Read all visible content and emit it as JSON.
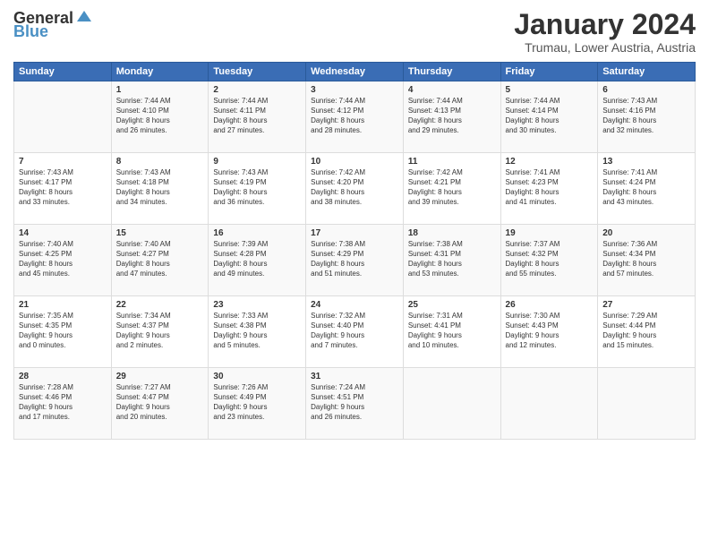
{
  "logo": {
    "general": "General",
    "blue": "Blue"
  },
  "title": "January 2024",
  "subtitle": "Trumau, Lower Austria, Austria",
  "header_days": [
    "Sunday",
    "Monday",
    "Tuesday",
    "Wednesday",
    "Thursday",
    "Friday",
    "Saturday"
  ],
  "weeks": [
    [
      {
        "day": "",
        "info": ""
      },
      {
        "day": "1",
        "info": "Sunrise: 7:44 AM\nSunset: 4:10 PM\nDaylight: 8 hours\nand 26 minutes."
      },
      {
        "day": "2",
        "info": "Sunrise: 7:44 AM\nSunset: 4:11 PM\nDaylight: 8 hours\nand 27 minutes."
      },
      {
        "day": "3",
        "info": "Sunrise: 7:44 AM\nSunset: 4:12 PM\nDaylight: 8 hours\nand 28 minutes."
      },
      {
        "day": "4",
        "info": "Sunrise: 7:44 AM\nSunset: 4:13 PM\nDaylight: 8 hours\nand 29 minutes."
      },
      {
        "day": "5",
        "info": "Sunrise: 7:44 AM\nSunset: 4:14 PM\nDaylight: 8 hours\nand 30 minutes."
      },
      {
        "day": "6",
        "info": "Sunrise: 7:43 AM\nSunset: 4:16 PM\nDaylight: 8 hours\nand 32 minutes."
      }
    ],
    [
      {
        "day": "7",
        "info": "Sunrise: 7:43 AM\nSunset: 4:17 PM\nDaylight: 8 hours\nand 33 minutes."
      },
      {
        "day": "8",
        "info": "Sunrise: 7:43 AM\nSunset: 4:18 PM\nDaylight: 8 hours\nand 34 minutes."
      },
      {
        "day": "9",
        "info": "Sunrise: 7:43 AM\nSunset: 4:19 PM\nDaylight: 8 hours\nand 36 minutes."
      },
      {
        "day": "10",
        "info": "Sunrise: 7:42 AM\nSunset: 4:20 PM\nDaylight: 8 hours\nand 38 minutes."
      },
      {
        "day": "11",
        "info": "Sunrise: 7:42 AM\nSunset: 4:21 PM\nDaylight: 8 hours\nand 39 minutes."
      },
      {
        "day": "12",
        "info": "Sunrise: 7:41 AM\nSunset: 4:23 PM\nDaylight: 8 hours\nand 41 minutes."
      },
      {
        "day": "13",
        "info": "Sunrise: 7:41 AM\nSunset: 4:24 PM\nDaylight: 8 hours\nand 43 minutes."
      }
    ],
    [
      {
        "day": "14",
        "info": "Sunrise: 7:40 AM\nSunset: 4:25 PM\nDaylight: 8 hours\nand 45 minutes."
      },
      {
        "day": "15",
        "info": "Sunrise: 7:40 AM\nSunset: 4:27 PM\nDaylight: 8 hours\nand 47 minutes."
      },
      {
        "day": "16",
        "info": "Sunrise: 7:39 AM\nSunset: 4:28 PM\nDaylight: 8 hours\nand 49 minutes."
      },
      {
        "day": "17",
        "info": "Sunrise: 7:38 AM\nSunset: 4:29 PM\nDaylight: 8 hours\nand 51 minutes."
      },
      {
        "day": "18",
        "info": "Sunrise: 7:38 AM\nSunset: 4:31 PM\nDaylight: 8 hours\nand 53 minutes."
      },
      {
        "day": "19",
        "info": "Sunrise: 7:37 AM\nSunset: 4:32 PM\nDaylight: 8 hours\nand 55 minutes."
      },
      {
        "day": "20",
        "info": "Sunrise: 7:36 AM\nSunset: 4:34 PM\nDaylight: 8 hours\nand 57 minutes."
      }
    ],
    [
      {
        "day": "21",
        "info": "Sunrise: 7:35 AM\nSunset: 4:35 PM\nDaylight: 9 hours\nand 0 minutes."
      },
      {
        "day": "22",
        "info": "Sunrise: 7:34 AM\nSunset: 4:37 PM\nDaylight: 9 hours\nand 2 minutes."
      },
      {
        "day": "23",
        "info": "Sunrise: 7:33 AM\nSunset: 4:38 PM\nDaylight: 9 hours\nand 5 minutes."
      },
      {
        "day": "24",
        "info": "Sunrise: 7:32 AM\nSunset: 4:40 PM\nDaylight: 9 hours\nand 7 minutes."
      },
      {
        "day": "25",
        "info": "Sunrise: 7:31 AM\nSunset: 4:41 PM\nDaylight: 9 hours\nand 10 minutes."
      },
      {
        "day": "26",
        "info": "Sunrise: 7:30 AM\nSunset: 4:43 PM\nDaylight: 9 hours\nand 12 minutes."
      },
      {
        "day": "27",
        "info": "Sunrise: 7:29 AM\nSunset: 4:44 PM\nDaylight: 9 hours\nand 15 minutes."
      }
    ],
    [
      {
        "day": "28",
        "info": "Sunrise: 7:28 AM\nSunset: 4:46 PM\nDaylight: 9 hours\nand 17 minutes."
      },
      {
        "day": "29",
        "info": "Sunrise: 7:27 AM\nSunset: 4:47 PM\nDaylight: 9 hours\nand 20 minutes."
      },
      {
        "day": "30",
        "info": "Sunrise: 7:26 AM\nSunset: 4:49 PM\nDaylight: 9 hours\nand 23 minutes."
      },
      {
        "day": "31",
        "info": "Sunrise: 7:24 AM\nSunset: 4:51 PM\nDaylight: 9 hours\nand 26 minutes."
      },
      {
        "day": "",
        "info": ""
      },
      {
        "day": "",
        "info": ""
      },
      {
        "day": "",
        "info": ""
      }
    ]
  ]
}
